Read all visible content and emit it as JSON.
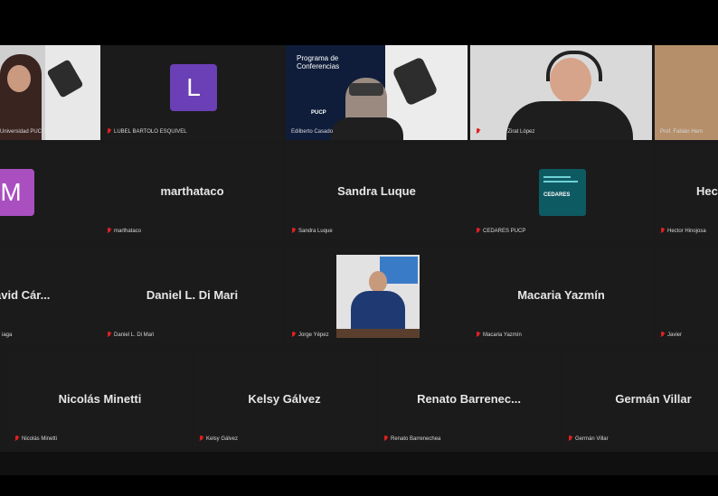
{
  "row1": [
    {
      "name": "Universidad PUCP",
      "id": "universidad-pucp"
    },
    {
      "name": "LUBEL BARTOLO ESQUIVEL",
      "id": "lubel",
      "avatar": "L"
    },
    {
      "name": "Edilberto Casado",
      "id": "edilberto",
      "slide_title": "Programa de Conferencias",
      "slide_logo": "PUCP"
    },
    {
      "name": "Fernando Zirat López",
      "id": "fernando"
    },
    {
      "name": "Prof. Fabián Hern",
      "id": "fabian"
    }
  ],
  "row2": [
    {
      "name": "",
      "tag": "",
      "id": "m-user",
      "avatar": "M"
    },
    {
      "name": "marthataco",
      "tag": "marthataco",
      "id": "marthataco"
    },
    {
      "name": "Sandra Luque",
      "tag": "Sandra Luque",
      "id": "sandra"
    },
    {
      "name": "",
      "tag": "CEDARES PUCP",
      "id": "cedares",
      "logo": "CEDARES"
    },
    {
      "name": "Hect",
      "tag": "Hector Hinojosa",
      "id": "hector"
    }
  ],
  "row3": [
    {
      "name": "avid Cár...",
      "tag": "iaga",
      "id": "david"
    },
    {
      "name": "Daniel L. Di Mari",
      "tag": "Daniel L. Di Mari",
      "id": "daniel"
    },
    {
      "name": "",
      "tag": "Jorge Yépez",
      "id": "jorge"
    },
    {
      "name": "Macaria Yazmín",
      "tag": "Macaria Yazmín",
      "id": "macaria"
    },
    {
      "name": "",
      "tag": "Javier",
      "id": "javier"
    }
  ],
  "row4": [
    {
      "name": "Nicolás Minetti",
      "tag": "Nicolás Minetti",
      "id": "nicolas"
    },
    {
      "name": "Kelsy Gálvez",
      "tag": "Kelsy Gálvez",
      "id": "kelsy"
    },
    {
      "name": "Renato  Barrenec...",
      "tag": "Renato Barrenechea",
      "id": "renato"
    },
    {
      "name": "Germán Villar",
      "tag": "Germán Villar",
      "id": "german"
    }
  ]
}
